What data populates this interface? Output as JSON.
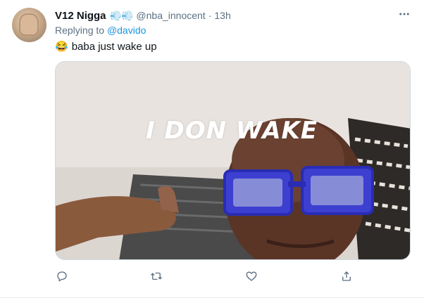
{
  "tweet": {
    "display_name": "V12 Nigga",
    "name_emojis": "💨💨",
    "handle": "@nba_innocent",
    "separator": "·",
    "time": "13h",
    "replying_prefix": "Replying to",
    "replying_to": "@davido",
    "text_emoji": "😂",
    "text": "baba just wake up",
    "media_caption": "I DON WAKE"
  },
  "icons": {
    "more": "more-horizontal-icon",
    "reply": "reply-icon",
    "retweet": "retweet-icon",
    "like": "like-icon",
    "share": "share-icon"
  },
  "colors": {
    "text_primary": "#0f1419",
    "text_secondary": "#5b7083",
    "link": "#1b95e0",
    "border": "#e6ecf0"
  }
}
